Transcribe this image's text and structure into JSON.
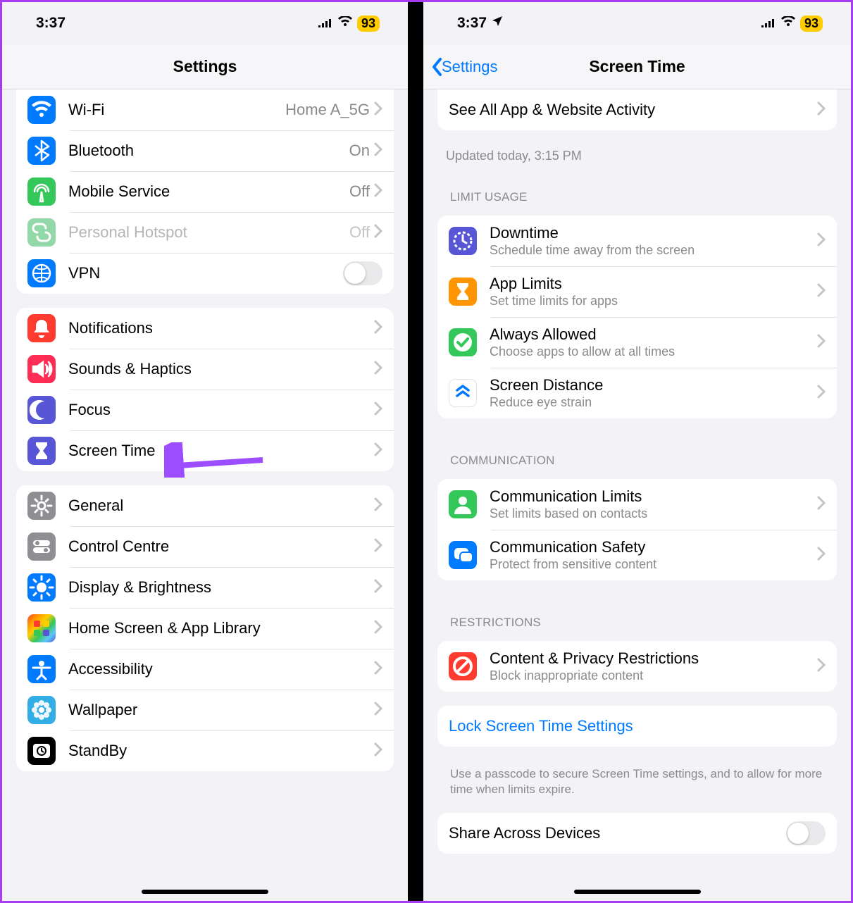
{
  "status": {
    "time": "3:37",
    "battery": "93"
  },
  "left_phone": {
    "title": "Settings",
    "groups": [
      {
        "rows": [
          {
            "icon": "wifi",
            "color": "ic-blue",
            "title": "Wi-Fi",
            "value": "Home A_5G",
            "chev": true
          },
          {
            "icon": "bluetooth",
            "color": "ic-blue",
            "title": "Bluetooth",
            "value": "On",
            "chev": true
          },
          {
            "icon": "antenna",
            "color": "ic-green",
            "title": "Mobile Service",
            "value": "Off",
            "chev": true
          },
          {
            "icon": "link",
            "color": "ic-mint",
            "title": "Personal Hotspot",
            "value": "Off",
            "dim": true,
            "chev": true
          },
          {
            "icon": "globe",
            "color": "ic-blue",
            "title": "VPN",
            "toggle": true
          }
        ]
      },
      {
        "rows": [
          {
            "icon": "bell",
            "color": "ic-red",
            "title": "Notifications",
            "chev": true
          },
          {
            "icon": "speaker",
            "color": "ic-pink",
            "title": "Sounds & Haptics",
            "chev": true
          },
          {
            "icon": "moon",
            "color": "ic-indigo",
            "title": "Focus",
            "chev": true
          },
          {
            "icon": "hourglass",
            "color": "ic-indigo",
            "title": "Screen Time",
            "chev": true,
            "arrow_target": true
          }
        ]
      },
      {
        "rows": [
          {
            "icon": "gear",
            "color": "ic-gray",
            "title": "General",
            "chev": true
          },
          {
            "icon": "switches",
            "color": "ic-gray",
            "title": "Control Centre",
            "chev": true
          },
          {
            "icon": "brightness",
            "color": "ic-blue",
            "title": "Display & Brightness",
            "chev": true
          },
          {
            "icon": "apps",
            "color": "ic-rainbow",
            "title": "Home Screen & App Library",
            "chev": true
          },
          {
            "icon": "accessibility",
            "color": "ic-blue",
            "title": "Accessibility",
            "chev": true
          },
          {
            "icon": "flower",
            "color": "ic-teal",
            "title": "Wallpaper",
            "chev": true
          },
          {
            "icon": "clock",
            "color": "ic-black",
            "title": "StandBy",
            "chev": true
          }
        ]
      }
    ]
  },
  "right_phone": {
    "back_label": "Settings",
    "title": "Screen Time",
    "see_all": "See All App & Website Activity",
    "updated": "Updated today, 3:15 PM",
    "sections": [
      {
        "header": "LIMIT USAGE",
        "rows": [
          {
            "icon": "downtime",
            "color": "ic-indigo",
            "title": "Downtime",
            "sub": "Schedule time away from the screen"
          },
          {
            "icon": "timer",
            "color": "ic-orange",
            "title": "App Limits",
            "sub": "Set time limits for apps"
          },
          {
            "icon": "check",
            "color": "ic-green",
            "title": "Always Allowed",
            "sub": "Choose apps to allow at all times"
          },
          {
            "icon": "distance",
            "color": "ic-white",
            "title": "Screen Distance",
            "sub": "Reduce eye strain"
          }
        ]
      },
      {
        "header": "COMMUNICATION",
        "rows": [
          {
            "icon": "person",
            "color": "ic-green",
            "title": "Communication Limits",
            "sub": "Set limits based on contacts"
          },
          {
            "icon": "bubble",
            "color": "ic-blue",
            "title": "Communication Safety",
            "sub": "Protect from sensitive content"
          }
        ]
      },
      {
        "header": "RESTRICTIONS",
        "rows": [
          {
            "icon": "nosign",
            "color": "ic-red",
            "title": "Content & Privacy Restrictions",
            "sub": "Block inappropriate content",
            "highlight": true
          }
        ]
      }
    ],
    "lock_label": "Lock Screen Time Settings",
    "lock_caption": "Use a passcode to secure Screen Time settings, and to allow for more time when limits expire.",
    "share_label": "Share Across Devices"
  }
}
